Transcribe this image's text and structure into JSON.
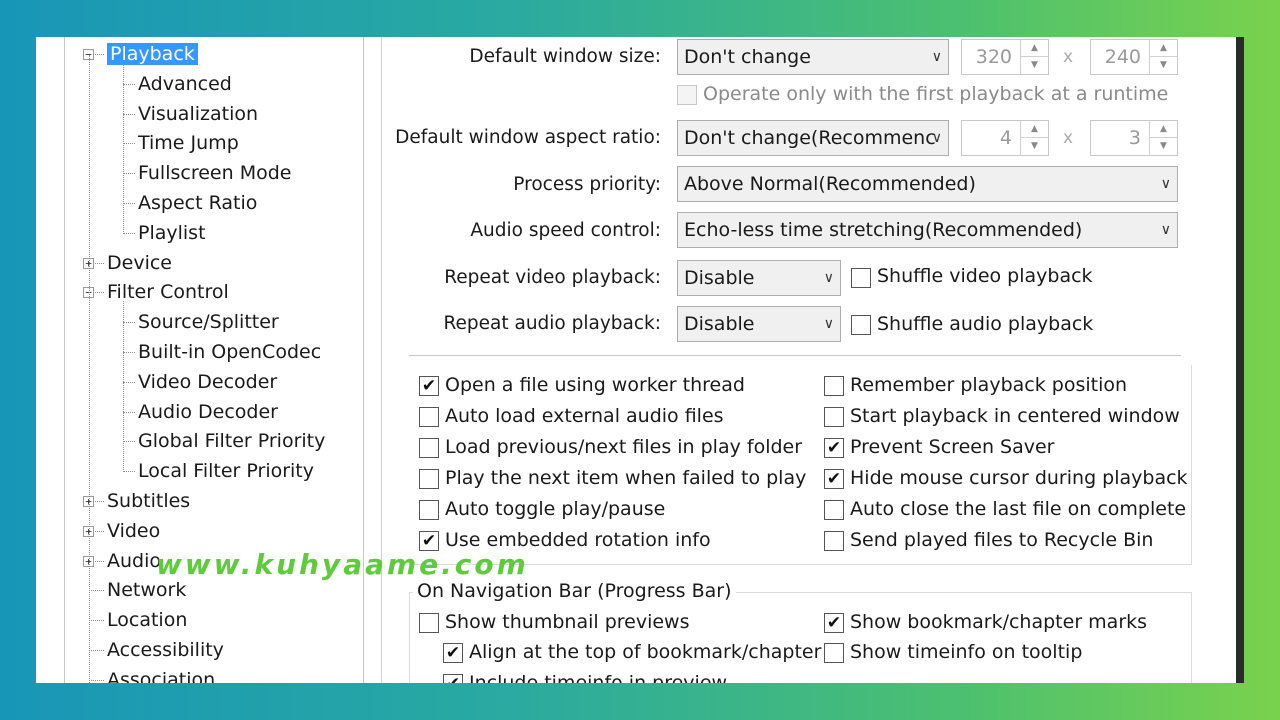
{
  "tree": {
    "items": [
      {
        "label": "Playback",
        "level": 0,
        "expander": "minus",
        "selected": true
      },
      {
        "label": "Advanced",
        "level": 1
      },
      {
        "label": "Visualization",
        "level": 1
      },
      {
        "label": "Time Jump",
        "level": 1
      },
      {
        "label": "Fullscreen Mode",
        "level": 1
      },
      {
        "label": "Aspect Ratio",
        "level": 1
      },
      {
        "label": "Playlist",
        "level": 1
      },
      {
        "label": "Device",
        "level": 0,
        "expander": "plus"
      },
      {
        "label": "Filter Control",
        "level": 0,
        "expander": "minus"
      },
      {
        "label": "Source/Splitter",
        "level": 1
      },
      {
        "label": "Built-in OpenCodec",
        "level": 1
      },
      {
        "label": "Video Decoder",
        "level": 1
      },
      {
        "label": "Audio Decoder",
        "level": 1
      },
      {
        "label": "Global Filter Priority",
        "level": 1
      },
      {
        "label": "Local Filter Priority",
        "level": 1
      },
      {
        "label": "Subtitles",
        "level": 0,
        "expander": "plus"
      },
      {
        "label": "Video",
        "level": 0,
        "expander": "plus"
      },
      {
        "label": "Audio",
        "level": 0,
        "expander": "plus"
      },
      {
        "label": "Network",
        "level": 0
      },
      {
        "label": "Location",
        "level": 0
      },
      {
        "label": "Accessibility",
        "level": 0
      },
      {
        "label": "Association",
        "level": 0
      }
    ]
  },
  "fields": {
    "window_size_label": "Default window size:",
    "window_size_value": "Don't change",
    "width_value": "320",
    "height_value": "240",
    "times_sign": "x",
    "operate_first_label": "Operate only with the first playback at a runtime",
    "aspect_label": "Default window aspect ratio:",
    "aspect_value": "Don't change(Recommenc",
    "aspect_w": "4",
    "aspect_h": "3",
    "priority_label": "Process priority:",
    "priority_value": "Above Normal(Recommended)",
    "audio_speed_label": "Audio speed control:",
    "audio_speed_value": "Echo-less time stretching(Recommended)",
    "repeat_video_label": "Repeat video playback:",
    "repeat_video_value": "Disable",
    "shuffle_video_label": "Shuffle video playback",
    "repeat_audio_label": "Repeat audio playback:",
    "repeat_audio_value": "Disable",
    "shuffle_audio_label": "Shuffle audio playback"
  },
  "options_left": [
    {
      "label": "Open a file using worker thread",
      "checked": true
    },
    {
      "label": "Auto load external audio files",
      "checked": false
    },
    {
      "label": "Load previous/next files in play folder",
      "checked": false
    },
    {
      "label": "Play the next item when failed to play",
      "checked": false
    },
    {
      "label": "Auto toggle play/pause",
      "checked": false
    },
    {
      "label": "Use embedded rotation info",
      "checked": true
    }
  ],
  "options_right": [
    {
      "label": "Remember playback position",
      "checked": false
    },
    {
      "label": "Start playback in centered window",
      "checked": false
    },
    {
      "label": "Prevent Screen Saver",
      "checked": true
    },
    {
      "label": "Hide mouse cursor during playback",
      "checked": true
    },
    {
      "label": "Auto close the last file on complete",
      "checked": false
    },
    {
      "label": "Send played files to Recycle Bin",
      "checked": false
    }
  ],
  "nav_bar": {
    "title": "On Navigation Bar (Progress Bar)",
    "show_thumbnail": "Show thumbnail previews",
    "align_top": "Align at the top of bookmark/chapter",
    "include_timeinfo": "Include timeinfo in preview",
    "show_bookmark": "Show bookmark/chapter marks",
    "show_timeinfo_tooltip": "Show timeinfo on tooltip"
  },
  "check_glyph": "✔",
  "watermark": "www.kuhyaame.com",
  "colors": {
    "selection": "#3399ff",
    "watermark": "#5ecb3c"
  }
}
